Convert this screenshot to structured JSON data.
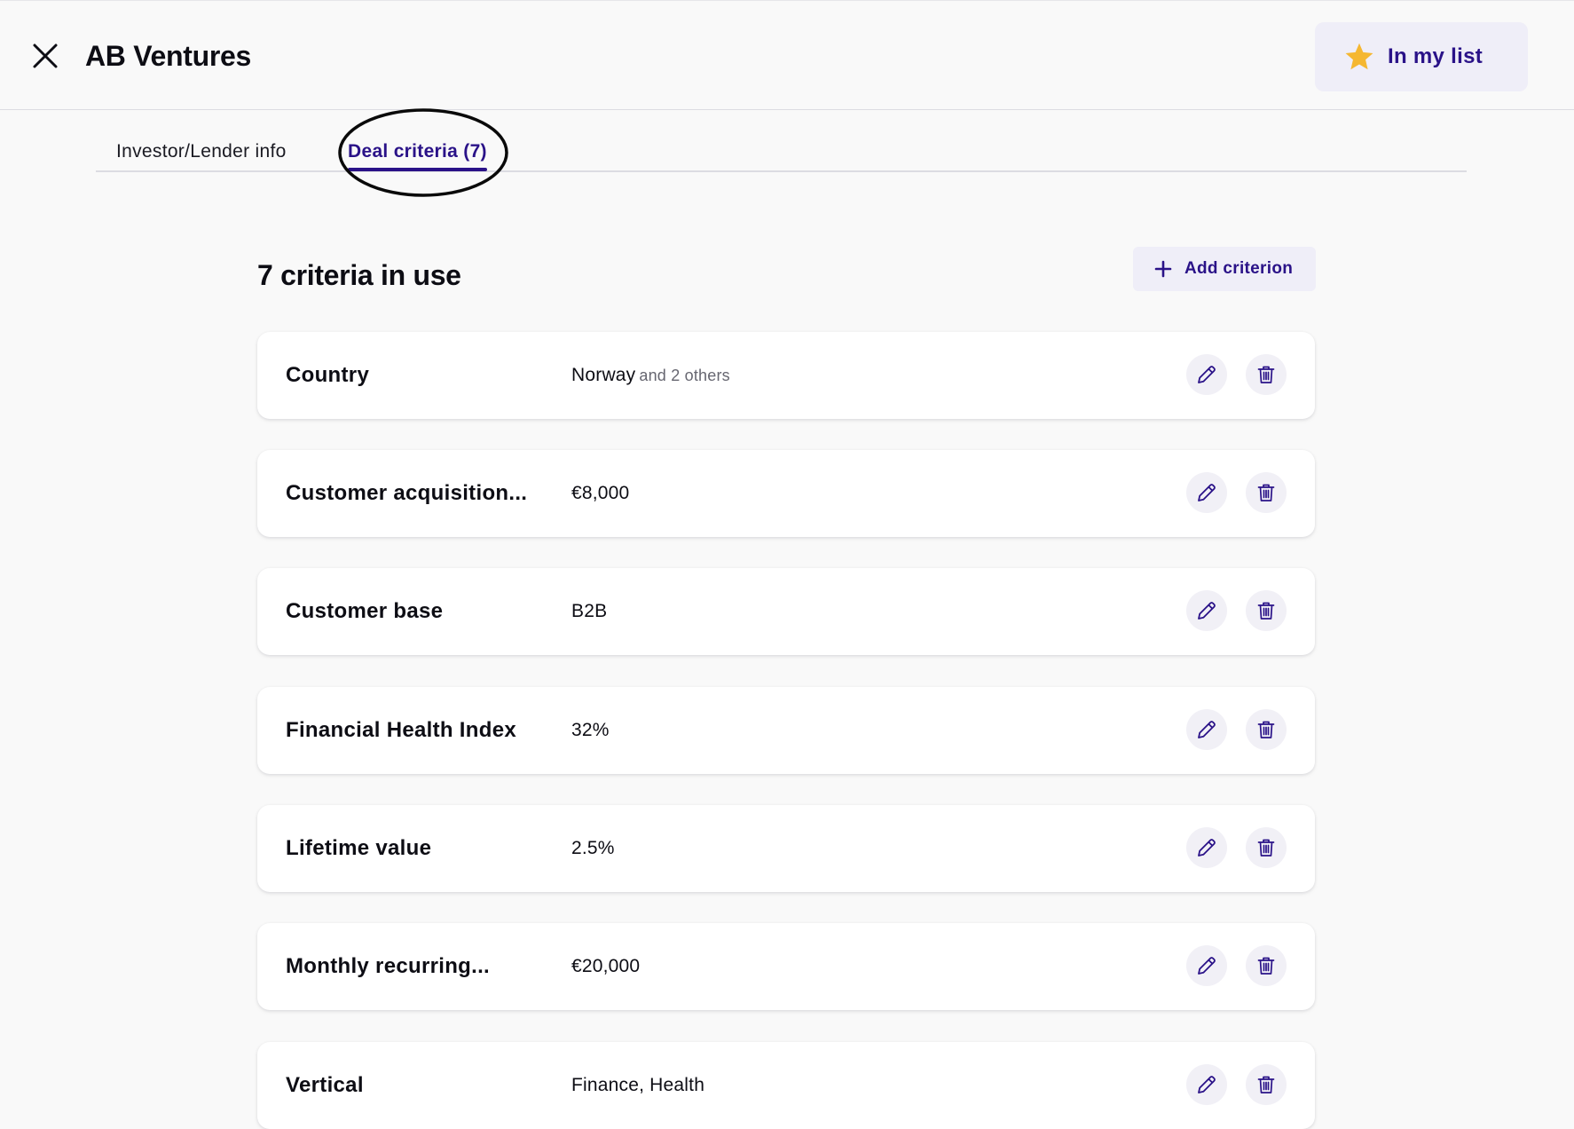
{
  "header": {
    "title": "AB Ventures",
    "my_list_label": "In my list"
  },
  "tabs": [
    {
      "label": "Investor/Lender info",
      "active": false
    },
    {
      "label": "Deal criteria (7)",
      "active": true
    }
  ],
  "criteria_section": {
    "title": "7 criteria in use",
    "add_label": "Add criterion",
    "items": [
      {
        "name": "Country",
        "value": "Norway",
        "extra": "and 2 others"
      },
      {
        "name": "Customer acquisition...",
        "value": "€8,000",
        "extra": ""
      },
      {
        "name": "Customer base",
        "value": "B2B",
        "extra": ""
      },
      {
        "name": "Financial Health Index",
        "value": "32%",
        "extra": ""
      },
      {
        "name": "Lifetime value",
        "value": "2.5%",
        "extra": ""
      },
      {
        "name": "Monthly recurring...",
        "value": "€20,000",
        "extra": ""
      },
      {
        "name": "Vertical",
        "value": "Finance, Health",
        "extra": ""
      }
    ]
  },
  "colors": {
    "accent": "#2a1288",
    "star": "#f5b731",
    "button_bg": "#efeef8",
    "page_bg": "#f9f9f9"
  },
  "icons": [
    "close-icon",
    "star-icon",
    "plus-icon",
    "pencil-icon",
    "trash-icon"
  ]
}
